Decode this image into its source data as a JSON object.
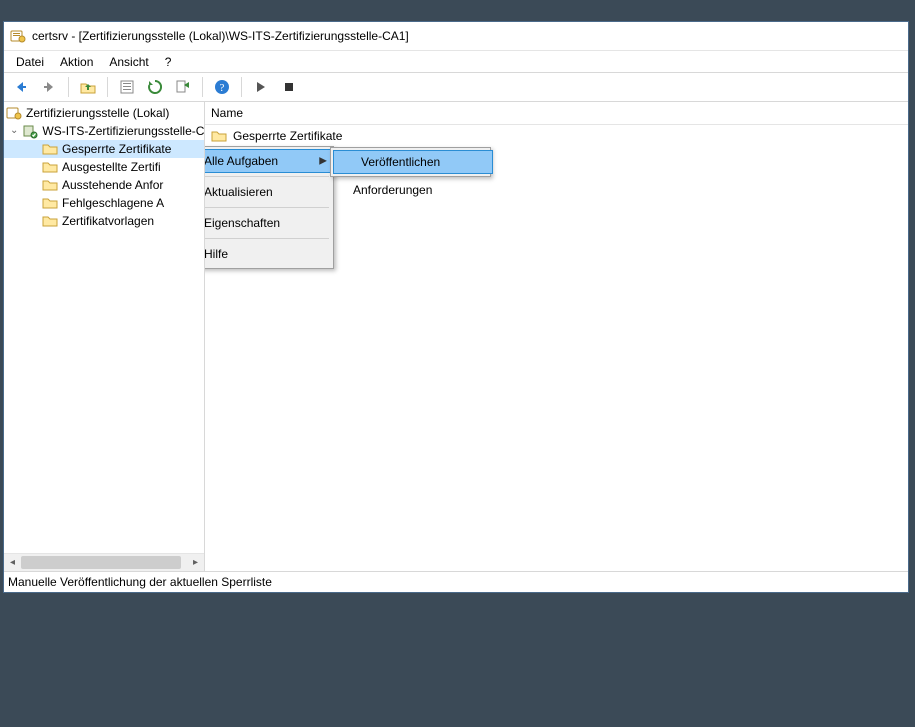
{
  "window": {
    "title": "certsrv - [Zertifizierungsstelle (Lokal)\\WS-ITS-Zertifizierungsstelle-CA1]"
  },
  "menubar": {
    "file": "Datei",
    "action": "Aktion",
    "view": "Ansicht",
    "help": "?"
  },
  "tree": {
    "root": "Zertifizierungsstelle (Lokal)",
    "ca": "WS-ITS-Zertifizierungsstelle-C",
    "revoked": "Gesperrte Zertifikate",
    "issued": "Ausgestellte Zertifi",
    "pending": "Ausstehende Anfor",
    "failed": "Fehlgeschlagene A",
    "templates": "Zertifikatvorlagen"
  },
  "list": {
    "header_name": "Name",
    "rows": {
      "revoked": "Gesperrte Zertifikate",
      "partial2": "",
      "partial3": "Anforderungen"
    }
  },
  "ctx": {
    "all_tasks": "Alle Aufgaben",
    "refresh": "Aktualisieren",
    "properties": "Eigenschaften",
    "help": "Hilfe",
    "publish": "Veröffentlichen"
  },
  "status": {
    "text": "Manuelle Veröffentlichung der aktuellen Sperrliste"
  }
}
